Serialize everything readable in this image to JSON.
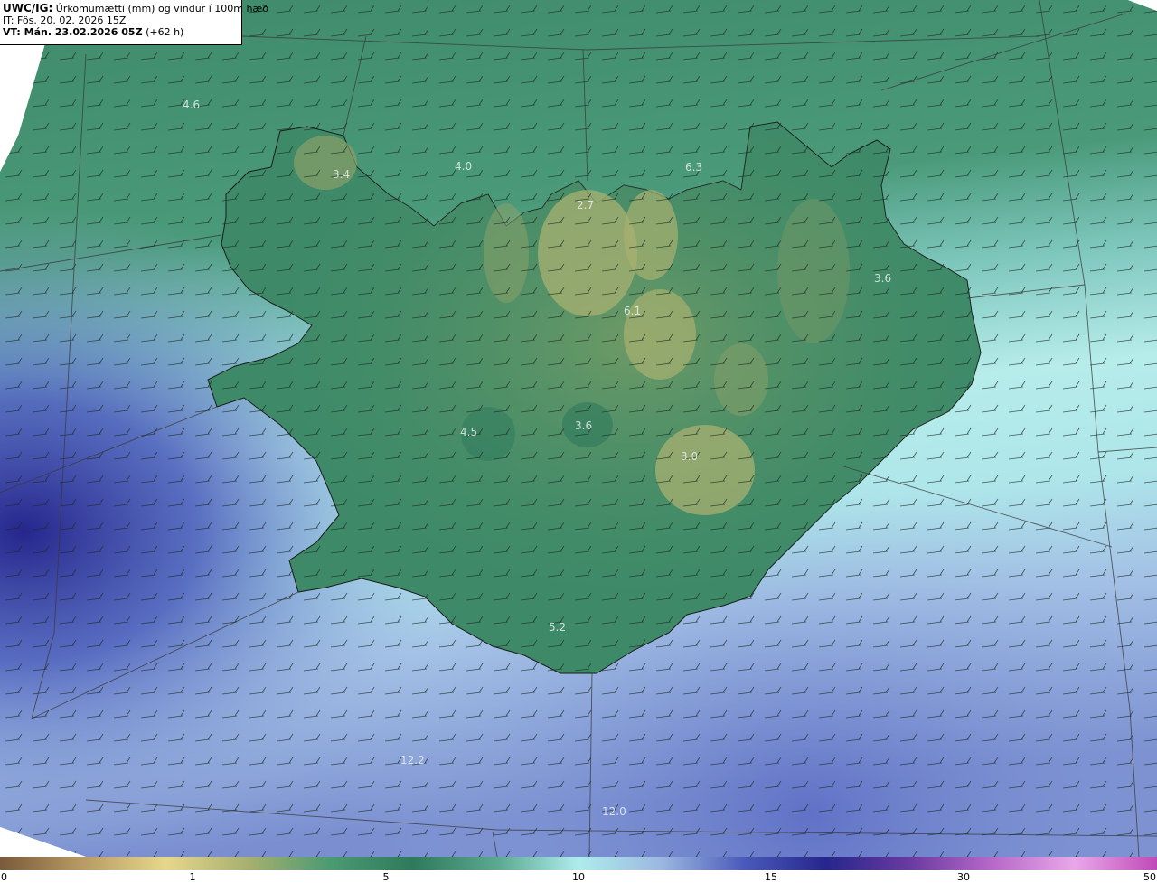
{
  "header": {
    "line1_code": "UWC/IG:",
    "line1_text": "Úrkomumætti (mm) og vindur í 100m hæð",
    "line2_text": "IT: Fös. 20. 02. 2026 15Z",
    "line3_bold": "VT: Mán. 23.02.2026 05Z",
    "line3_text": "(+62 h)"
  },
  "map_values": [
    "4.6",
    "3.4",
    "4.0",
    "6.3",
    "2.7",
    "3.6",
    "6.1",
    "4.5",
    "3.6",
    "3.0",
    "5.2",
    "12.2",
    "12.0"
  ],
  "colorbar": {
    "ticks": [
      "0",
      "1",
      "5",
      "10",
      "15",
      "30",
      "50"
    ],
    "colors": [
      "#7a5a3a",
      "#b89a64",
      "#e6d78c",
      "#a8b070",
      "#4a9a72",
      "#2e7a5c",
      "#5aa890",
      "#aeecec",
      "#9cb8e0",
      "#4a5aba",
      "#26268c",
      "#6a3aa0",
      "#b668c8",
      "#e8a8e8",
      "#c04ab8"
    ]
  }
}
